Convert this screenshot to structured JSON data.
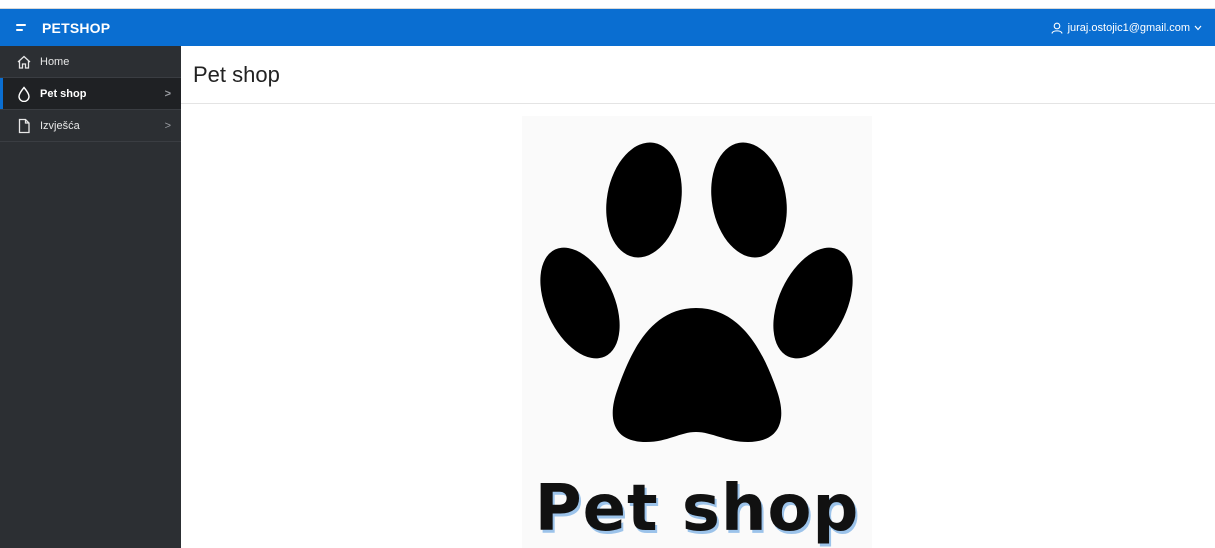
{
  "app": {
    "title": "PETSHOP"
  },
  "user": {
    "email": "juraj.ostojic1@gmail.com"
  },
  "sidebar": {
    "items": [
      {
        "label": "Home",
        "icon": "home-icon"
      },
      {
        "label": "Pet shop",
        "icon": "drop-icon"
      },
      {
        "label": "Izvješća",
        "icon": "document-icon"
      }
    ]
  },
  "page": {
    "title": "Pet shop"
  },
  "hero": {
    "logo_text": "Pet shop",
    "icon": "paw-icon"
  },
  "colors": {
    "header": "#0a6ed1",
    "sidebar": "#2c2f33",
    "active_item": "#1f2124",
    "logo_shadow": "#9cc3ea"
  }
}
